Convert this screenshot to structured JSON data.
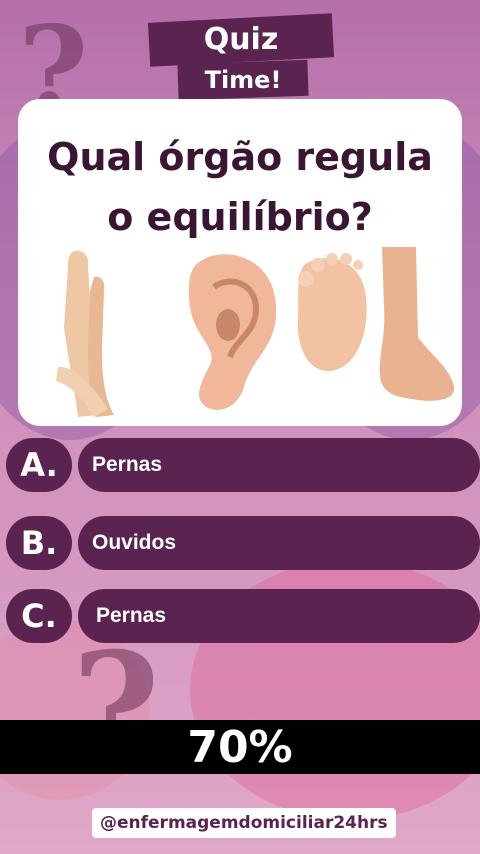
{
  "header": {
    "line1": "Quiz",
    "line2": "Time!"
  },
  "question": {
    "line1": "Qual órgão regula",
    "line2": "o equilíbrio?"
  },
  "illustrations": [
    "legs",
    "ear",
    "sole-of-foot",
    "foot-side"
  ],
  "options": [
    {
      "letter": "A.",
      "label": "Pernas"
    },
    {
      "letter": "B.",
      "label": "Ouvidos"
    },
    {
      "letter": "C.",
      "label": "Pernas"
    }
  ],
  "progress": {
    "text": "70%",
    "value": 0.7
  },
  "footer": {
    "handle": "@enfermagemdomiciliar24hrs"
  },
  "colors": {
    "accent": "#5a2350",
    "question_text": "#3b1534",
    "bar": "#000000"
  }
}
